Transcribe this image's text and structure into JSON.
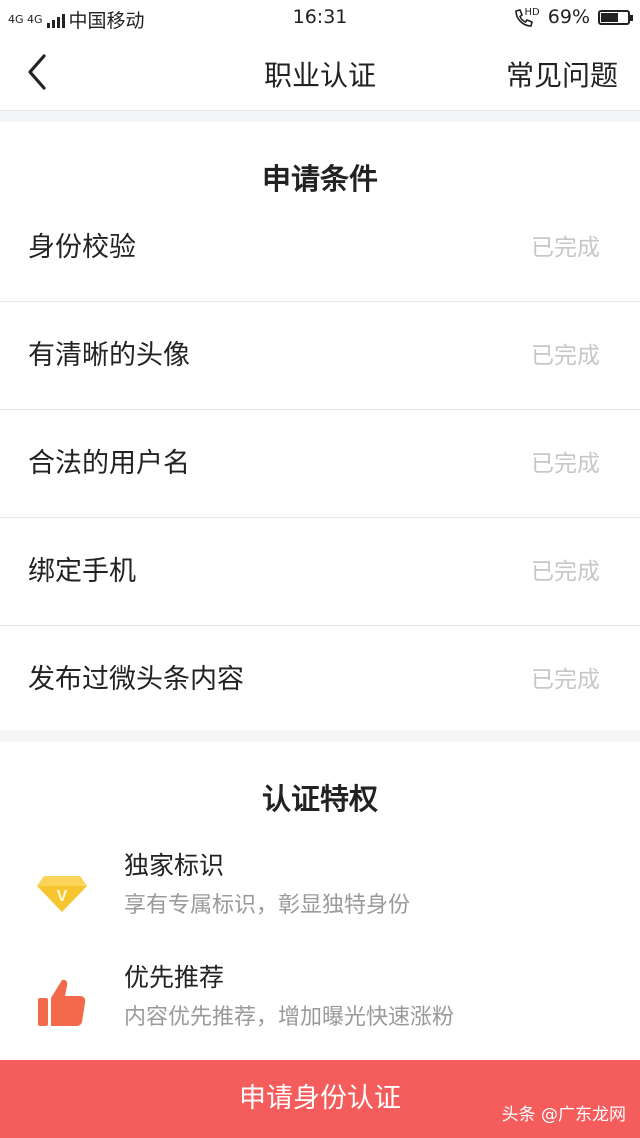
{
  "statusbar": {
    "network": "4G 4G",
    "carrier": "中国移动",
    "time": "16:31",
    "hd": "HD",
    "battery": "69%",
    "battery_level": 0.69
  },
  "nav": {
    "title": "职业认证",
    "faq": "常见问题"
  },
  "conditions": {
    "title": "申请条件",
    "items": [
      {
        "label": "身份校验",
        "status": "已完成"
      },
      {
        "label": "有清晰的头像",
        "status": "已完成"
      },
      {
        "label": "合法的用户名",
        "status": "已完成"
      },
      {
        "label": "绑定手机",
        "status": "已完成"
      },
      {
        "label": "发布过微头条内容",
        "status": "已完成"
      }
    ]
  },
  "privileges": {
    "title": "认证特权",
    "items": [
      {
        "name": "独家标识",
        "desc": "享有专属标识，彰显独特身份",
        "icon": "diamond-v-icon",
        "color": "#f7c530"
      },
      {
        "name": "优先推荐",
        "desc": "内容优先推荐，增加曝光快速涨粉",
        "icon": "thumbs-up-icon",
        "color": "#f26a4b"
      }
    ]
  },
  "cta": {
    "label": "申请身份认证",
    "color": "#f55c5c"
  },
  "watermark": "头条 @广东龙网"
}
